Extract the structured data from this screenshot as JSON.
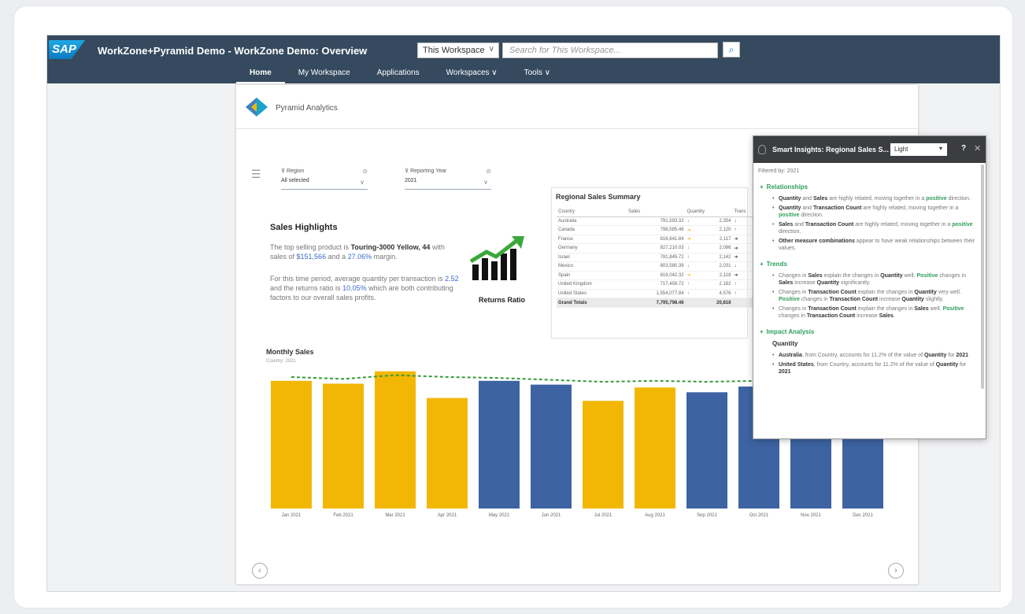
{
  "shell": {
    "logo": "SAP",
    "title": "WorkZone+Pyramid Demo - WorkZone Demo: Overview",
    "scope_select": "This Workspace",
    "search_placeholder": "Search for This Workspace...",
    "nav": [
      "Home",
      "My Workspace",
      "Applications",
      "Workspaces ∨",
      "Tools ∨"
    ]
  },
  "pyramid": {
    "brand": "Pyramid Analytics",
    "filters": [
      {
        "label": "Region",
        "value": "All selected"
      },
      {
        "label": "Reporting Year",
        "value": "2021"
      }
    ],
    "highlights": {
      "title": "Sales Highlights",
      "p1_a": "The top selling product is ",
      "p1_product": "Touring-3000 Yellow, 44",
      "p1_b": " with sales of ",
      "p1_sales": "$151,566",
      "p1_c": " and a ",
      "p1_margin": "27.06%",
      "p1_d": " margin.",
      "p2_a": "For this time period, average quantity per transaction is ",
      "p2_qty": "2.52",
      "p2_b": " and the returns ratio is ",
      "p2_ratio": "10.05%",
      "p2_c": " which are both contributing factors to our overall sales profits."
    },
    "returns_ratio_label": "Returns Ratio",
    "summary": {
      "title": "Regional Sales Summary",
      "columns": [
        "Country",
        "Sales",
        "Quantity",
        "Trans"
      ],
      "rows": [
        {
          "country": "Australia",
          "sales": "791,593.32",
          "qty_dir": "down",
          "qty": "2,354",
          "trans_dir": "down"
        },
        {
          "country": "Canada",
          "sales": "798,585.46",
          "qty_dir": "side",
          "qty": "2,120",
          "trans_dir": "up"
        },
        {
          "country": "France",
          "sales": "816,641.84",
          "qty_dir": "side",
          "qty": "2,117",
          "trans_dir": "side"
        },
        {
          "country": "Germany",
          "sales": "827,210.03",
          "qty_dir": "down",
          "qty": "2,086",
          "trans_dir": "side"
        },
        {
          "country": "Israel",
          "sales": "781,845.72",
          "qty_dir": "up",
          "qty": "2,142",
          "trans_dir": "side"
        },
        {
          "country": "Mexico",
          "sales": "803,580.39",
          "qty_dir": "down",
          "qty": "2,031",
          "trans_dir": "down"
        },
        {
          "country": "Spain",
          "sales": "818,042.32",
          "qty_dir": "side",
          "qty": "2,118",
          "trans_dir": "side"
        },
        {
          "country": "United Kingdom",
          "sales": "717,458.72",
          "qty_dir": "up",
          "qty": "2,182",
          "trans_dir": "up"
        },
        {
          "country": "United States",
          "sales": "1,554,077.84",
          "qty_dir": "up",
          "qty": "4,576",
          "trans_dir": "up"
        }
      ],
      "grand_total": {
        "label": "Grand Totals",
        "sales": "7,795,798.46",
        "qty": "20,818"
      }
    },
    "monthly": {
      "title": "Monthly Sales",
      "subtitle": "Country: 2021"
    }
  },
  "chart_data": {
    "type": "bar",
    "title": "Monthly Sales",
    "categories": [
      "Jan 2021",
      "Feb 2021",
      "Mar 2021",
      "Apr 2021",
      "May 2021",
      "Jun 2021",
      "Jul 2021",
      "Aug 2021",
      "Sep 2021",
      "Oct 2021",
      "Nov 2021",
      "Dec 2021"
    ],
    "values": [
      670,
      655,
      720,
      580,
      670,
      650,
      565,
      635,
      610,
      640,
      620,
      650
    ],
    "bar_colors": [
      "#f2b705",
      "#f2b705",
      "#f2b705",
      "#f2b705",
      "#3d63a3",
      "#3d63a3",
      "#f2b705",
      "#f2b705",
      "#3d63a3",
      "#3d63a3",
      "#3d63a3",
      "#3d63a3"
    ],
    "trend": [
      690,
      680,
      700,
      690,
      685,
      675,
      665,
      670,
      665,
      670,
      668,
      672
    ],
    "ylim": [
      0,
      760
    ]
  },
  "insights": {
    "title": "Smart Insights: Regional Sales S...",
    "theme": "Light",
    "filtered_by": "Filtered by: 2021",
    "relationships_title": "Relationships",
    "relationships": [
      {
        "a": "Quantity",
        "m1": " and ",
        "b": "Sales",
        "m2": " are highly related, moving together in a ",
        "dir": "positive",
        "end": " direction."
      },
      {
        "a": "Quantity",
        "m1": " and ",
        "b": "Transaction Count",
        "m2": " are highly related, moving together in a ",
        "dir": "positive",
        "end": " direction."
      },
      {
        "a": "Sales",
        "m1": " and ",
        "b": "Transaction Count",
        "m2": " are highly related, moving together in a ",
        "dir": "positive",
        "end": " direction."
      },
      {
        "a": "Other measure combinations",
        "m1": " appear to have weak relationships between their values.",
        "b": "",
        "m2": "",
        "dir": "",
        "end": ""
      }
    ],
    "trends_title": "Trends",
    "trends": [
      {
        "t1": "Changes in ",
        "a": "Sales",
        "t2": " explain the changes in ",
        "b": "Quantity",
        "t3": " well. ",
        "g": "Positive",
        "t4": " changes in ",
        "c": "Sales",
        "t5": " increase ",
        "d": "Quantity",
        "t6": " significantly."
      },
      {
        "t1": "Changes in ",
        "a": "Transaction Count",
        "t2": " explain the changes in ",
        "b": "Quantity",
        "t3": " very well. ",
        "g": "Positive",
        "t4": " changes in ",
        "c": "Transaction Count",
        "t5": " increase ",
        "d": "Quantity",
        "t6": " slightly."
      },
      {
        "t1": "Changes in ",
        "a": "Transaction Count",
        "t2": " explain the changes in ",
        "b": "Sales",
        "t3": " well. ",
        "g": "Positive",
        "t4": " changes in ",
        "c": "Transaction Count",
        "t5": " increase ",
        "d": "Sales",
        "t6": "."
      }
    ],
    "impact_title": "Impact Analysis",
    "impact_sub": "Quantity",
    "impact": [
      {
        "a": "Australia",
        "t1": ", from Country, accounts for 11.2% of the value of ",
        "b": "Quantity",
        "t2": " for ",
        "c": "2021"
      },
      {
        "a": "United States",
        "t1": ", from Country, accounts for 11.2% of the value of ",
        "b": "Quantity",
        "t2": " for ",
        "c": "2021"
      }
    ]
  }
}
